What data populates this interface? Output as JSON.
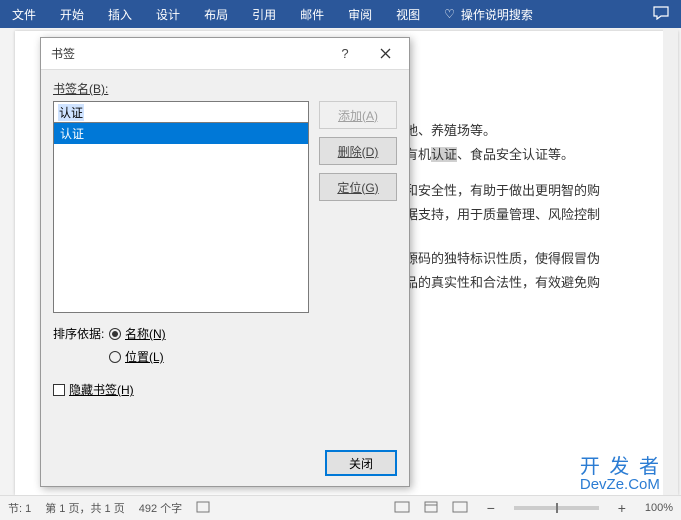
{
  "ribbon": {
    "tabs": [
      "文件",
      "开始",
      "插入",
      "设计",
      "布局",
      "引用",
      "邮件",
      "审阅",
      "视图"
    ],
    "search_label": "操作说明搜索"
  },
  "dialog": {
    "title": "书签",
    "name_label": "书签名(B):",
    "name_value": "认证",
    "list_items": [
      "认证"
    ],
    "buttons": {
      "add": "添加(A)",
      "delete": "删除(D)",
      "goto": "定位(G)"
    },
    "sort_label": "排序依据:",
    "sort_options": {
      "name": "名称(N)",
      "location": "位置(L)"
    },
    "hidden_label": "隐藏书签(H)",
    "close": "关闭"
  },
  "document": {
    "line1": "地、养殖场等。",
    "line2a": "有机",
    "line2b": "认证",
    "line2c": "、食品安全认证等。",
    "line3": "和安全性，有助于做出更明智的购",
    "line4": "据支持，用于质量管理、风险控制",
    "line5": "源码的独特标识性质，使得假冒伪",
    "line6": "品的真实性和合法性，有效避免购"
  },
  "status": {
    "section": "节: 1",
    "page": "第 1 页，共 1 页",
    "words": "492 个字",
    "zoom": "100%"
  },
  "watermark": {
    "line1": "开 发 者",
    "line2": "DevZe.CoM"
  }
}
